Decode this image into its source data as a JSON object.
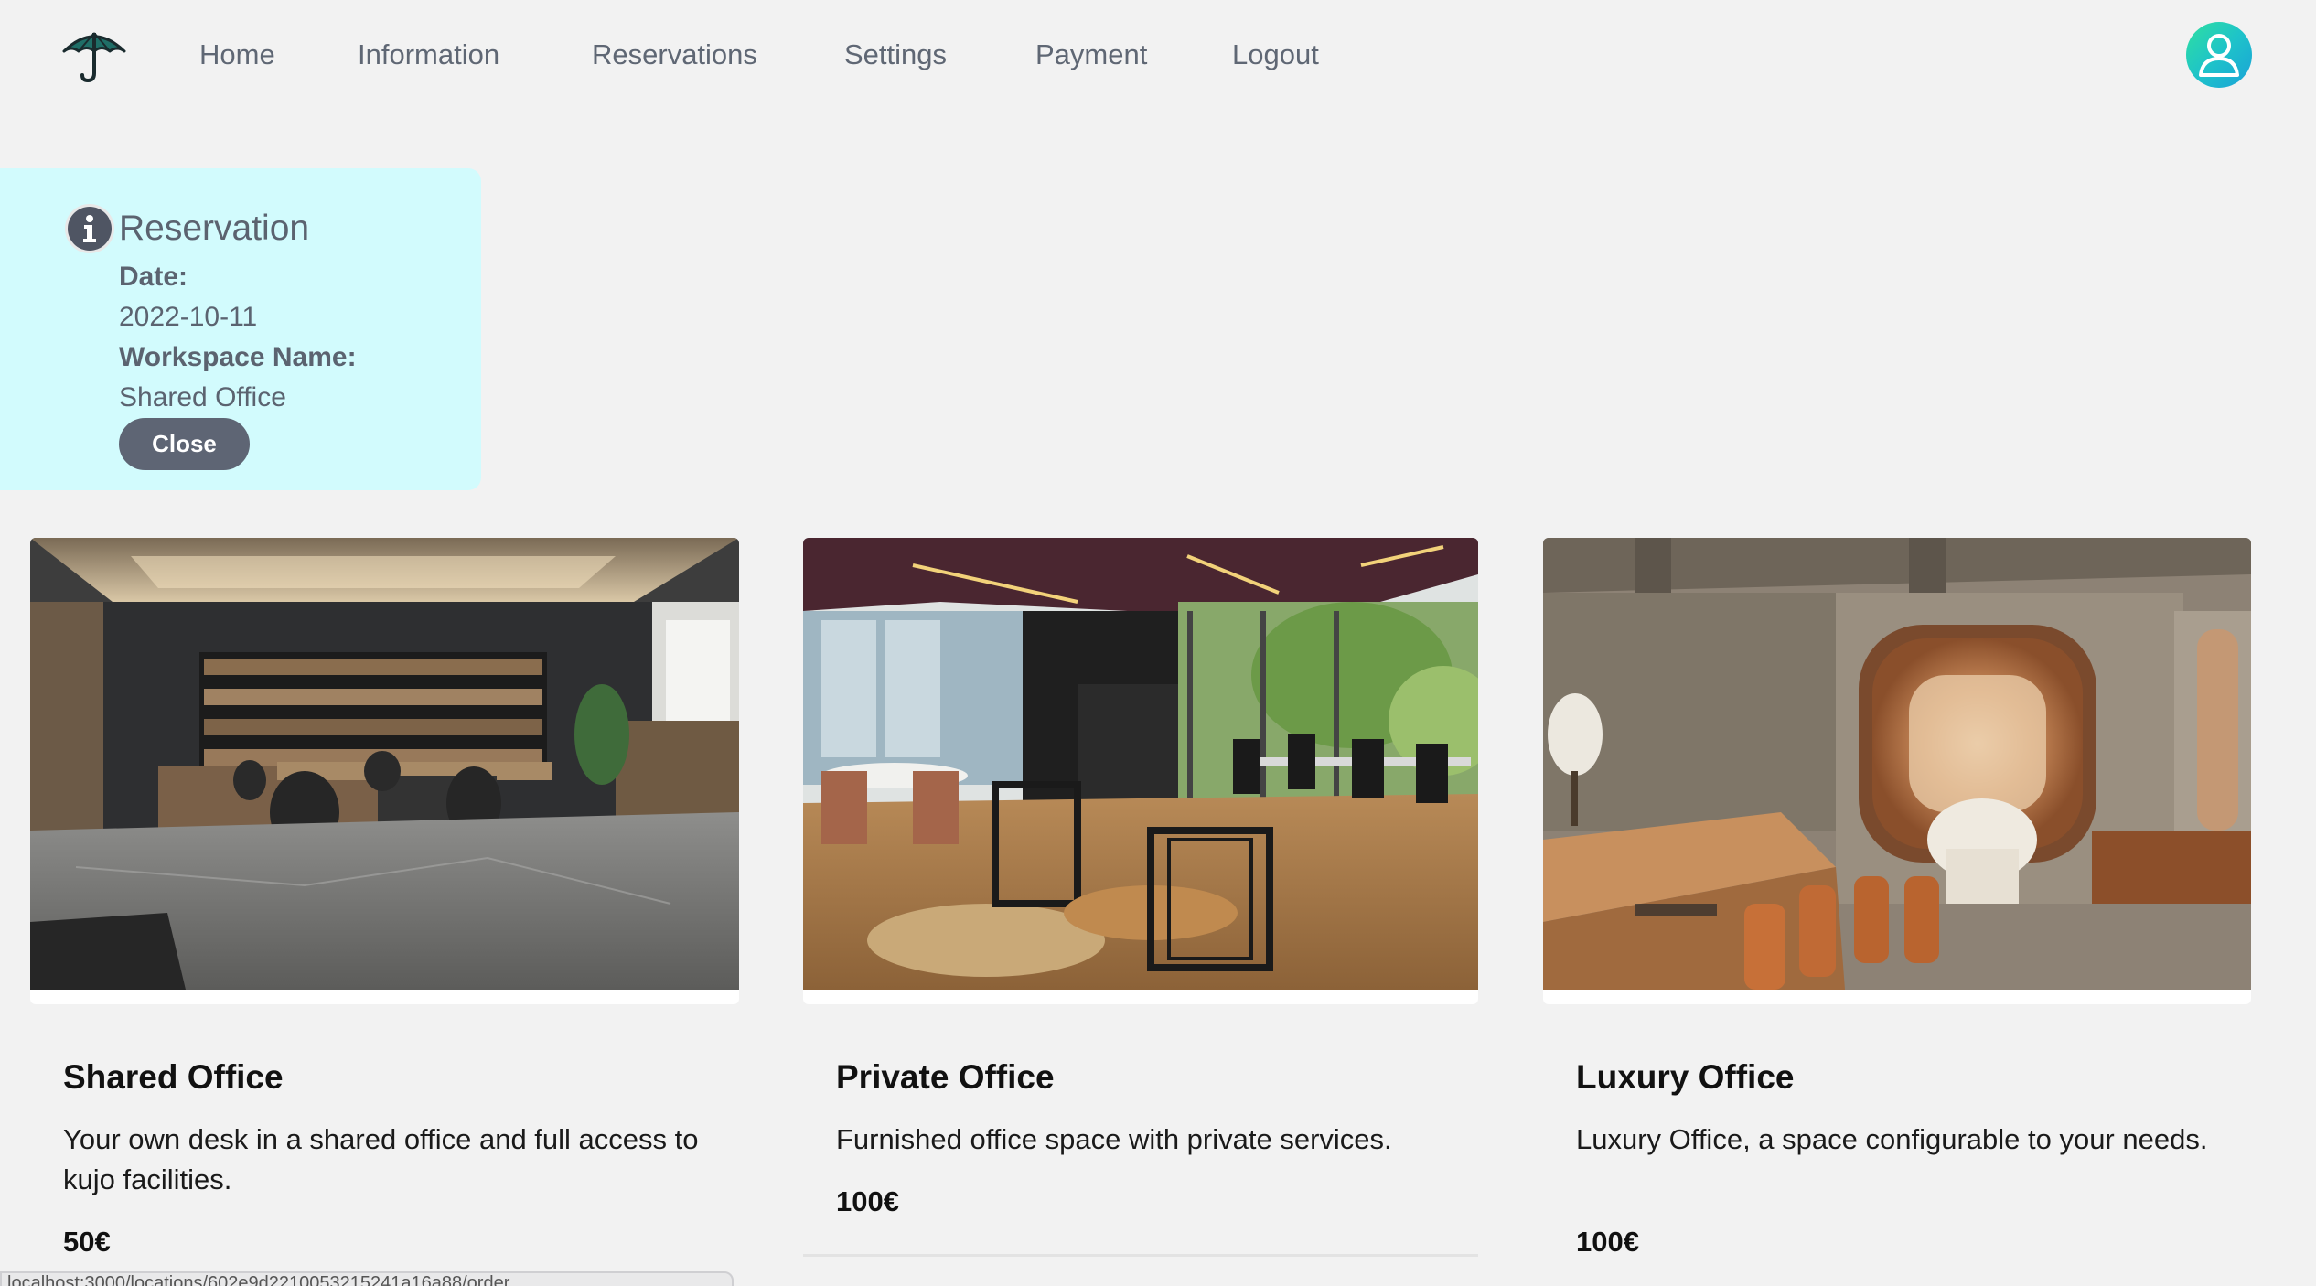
{
  "nav": {
    "items": [
      {
        "label": "Home"
      },
      {
        "label": "Information"
      },
      {
        "label": "Reservations"
      },
      {
        "label": "Settings"
      },
      {
        "label": "Payment"
      },
      {
        "label": "Logout"
      }
    ]
  },
  "reservation": {
    "title": "Reservation",
    "date_label": "Date:",
    "date_value": "2022-10-11",
    "workspace_label": "Workspace Name:",
    "workspace_value": "Shared Office",
    "close_label": "Close"
  },
  "offices": [
    {
      "name": "Shared Office",
      "description": "Your own desk in a shared office and full access to kujo facilities.",
      "price": "50€"
    },
    {
      "name": "Private Office",
      "description": "Furnished office space with private services.",
      "price": "100€"
    },
    {
      "name": "Luxury Office",
      "description": "Luxury Office, a space configurable to your needs.",
      "price": "100€"
    }
  ],
  "status_bar": {
    "url": "localhost:3000/locations/602e9d2210053215241a16a88/order"
  },
  "colors": {
    "nav_text": "#5f6774",
    "panel_bg": "#d2fbfd",
    "button_bg": "#5e6574",
    "avatar_gradient_start": "#2fe0a0",
    "avatar_gradient_end": "#1aa2d8"
  }
}
